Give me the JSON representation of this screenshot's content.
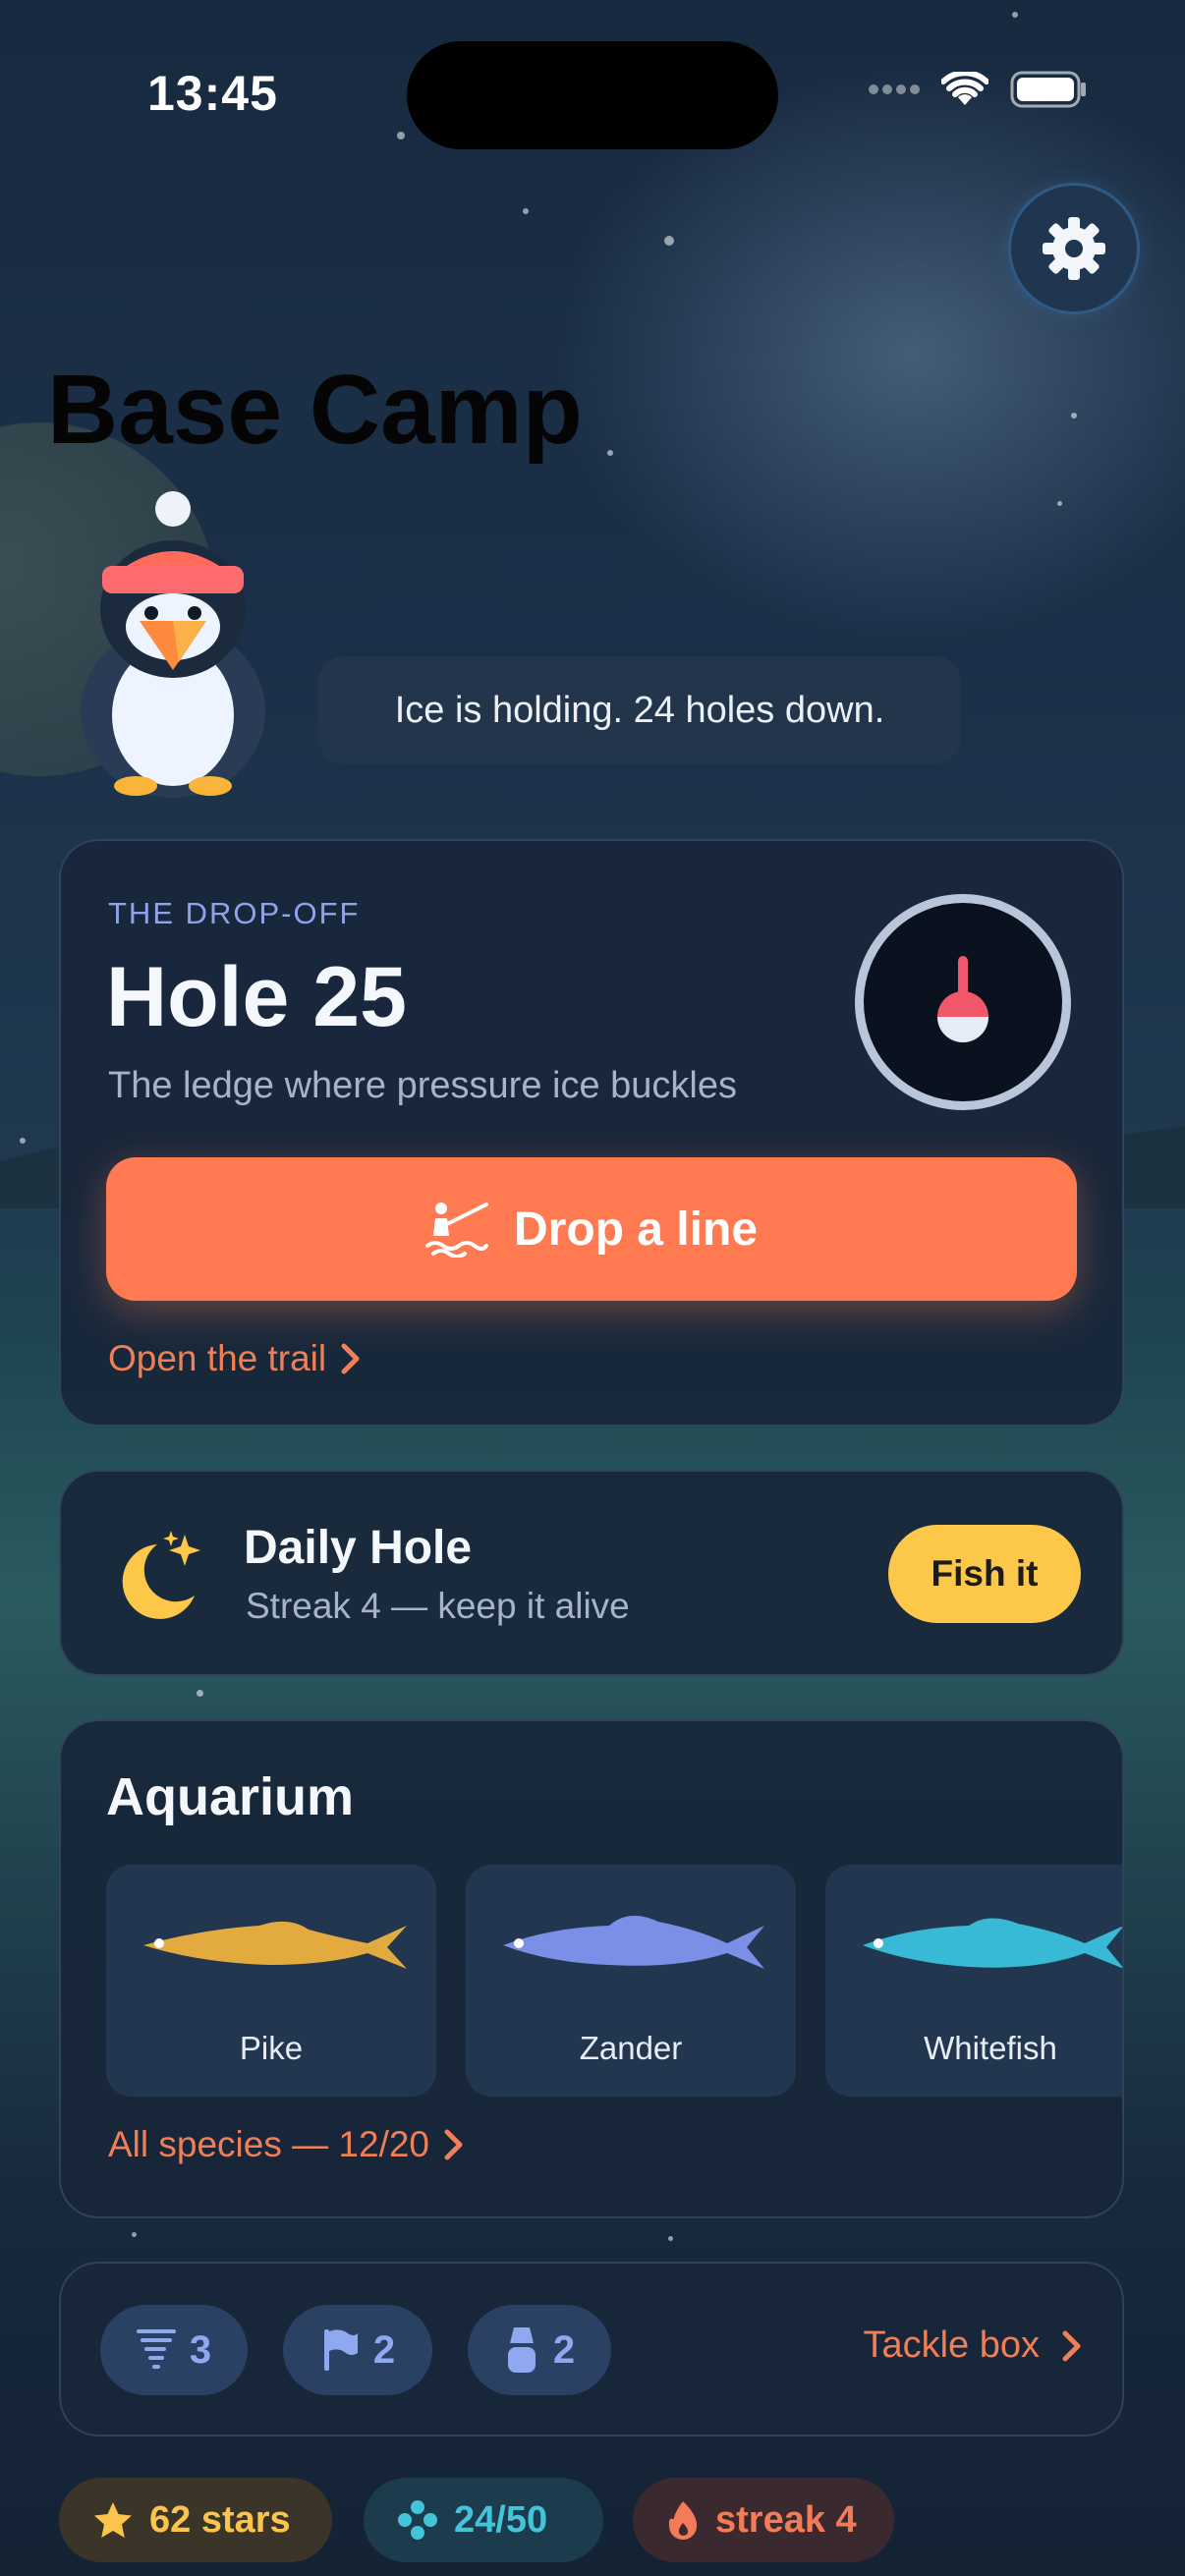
{
  "status_bar": {
    "time": "13:45"
  },
  "header": {
    "title": "Base Camp"
  },
  "mascot": {
    "speech": "Ice is holding. 24 holes down."
  },
  "dropoff_card": {
    "eyebrow": "THE DROP-OFF",
    "title": "Hole 25",
    "subtitle": "The ledge where pressure ice buckles",
    "primary_button": "Drop a line",
    "trail_link": "Open the trail"
  },
  "daily_card": {
    "title": "Daily Hole",
    "subtitle": "Streak 4 — keep it alive",
    "button": "Fish it"
  },
  "aquarium": {
    "title": "Aquarium",
    "fish": [
      {
        "name": "Pike",
        "color": "#e3aa40"
      },
      {
        "name": "Zander",
        "color": "#7b8fe6"
      },
      {
        "name": "Whitefish",
        "color": "#38b9d5"
      }
    ],
    "species_link": "All species — 12/20"
  },
  "tackle": {
    "items": [
      {
        "icon": "tornado-icon",
        "count": "3"
      },
      {
        "icon": "flag-icon",
        "count": "2"
      },
      {
        "icon": "lantern-icon",
        "count": "2"
      }
    ],
    "link": "Tackle box"
  },
  "footer_pills": {
    "stars": "62 stars",
    "progress": "24/50",
    "streak": "streak 4"
  },
  "colors": {
    "accent_orange": "#ff7a51",
    "accent_yellow": "#fdc84a",
    "accent_blue": "#8fa8f0",
    "card_bg": "#18263a"
  }
}
